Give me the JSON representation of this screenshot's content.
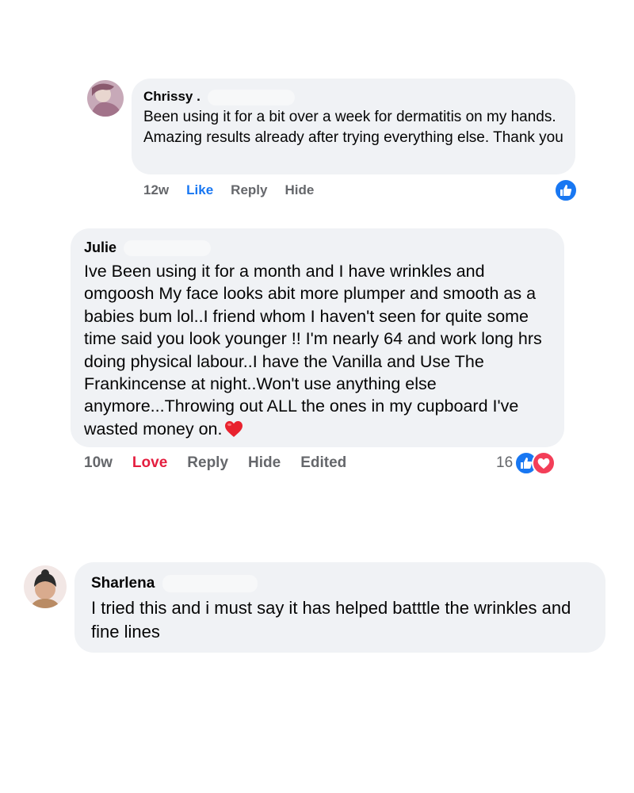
{
  "comments": [
    {
      "author": "Chrissy",
      "author_suffix": ".",
      "text": "Been using it for a bit over a week for dermatitis on my hands. Amazing results already after trying everything else. Thank you",
      "meta": {
        "time": "12w",
        "reaction": "Like",
        "reply": "Reply",
        "hide": "Hide"
      },
      "reactions": {
        "count": "",
        "types": [
          "like-icon"
        ]
      }
    },
    {
      "author": "Julie",
      "text": "Ive Been using it for a month and I have wrinkles and omgoosh My face looks abit more plumper and smooth as a babies bum lol..I friend whom I haven't seen for quite some time said you look younger !! I'm nearly 64 and work long hrs doing physical labour..I have the Vanilla and Use The Frankincense at night..Won't use anything else anymore...Throwing out ALL the ones in my cupboard I've wasted money on.",
      "emoji": "❤️",
      "meta": {
        "time": "10w",
        "reaction": "Love",
        "reply": "Reply",
        "hide": "Hide",
        "edited": "Edited"
      },
      "reactions": {
        "count": "16",
        "types": [
          "like-icon",
          "love-icon"
        ]
      }
    },
    {
      "author": "Sharlena",
      "text": "I tried this and i must say it has helped batttle the wrinkles and fine lines"
    }
  ],
  "colors": {
    "bubble": "#f0f2f5",
    "like": "#1877f2",
    "love": "#e41e3f",
    "meta": "#65676b"
  }
}
